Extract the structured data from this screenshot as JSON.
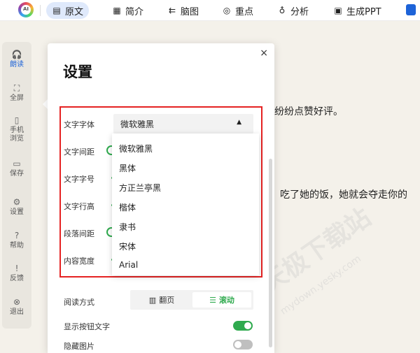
{
  "topbar": {
    "logo_text": "AI",
    "tabs": [
      {
        "label": "原文",
        "icon": "document-icon",
        "glyph": "▤"
      },
      {
        "label": "简介",
        "icon": "summary-icon",
        "glyph": "▦"
      },
      {
        "label": "脑图",
        "icon": "mindmap-icon",
        "glyph": "⇇"
      },
      {
        "label": "重点",
        "icon": "key-points-icon",
        "glyph": "◎"
      },
      {
        "label": "分析",
        "icon": "lightbulb-icon",
        "glyph": "♁"
      },
      {
        "label": "生成PPT",
        "icon": "ppt-icon",
        "glyph": "▣"
      }
    ]
  },
  "leftnav": {
    "items": [
      {
        "label": "朗读",
        "glyph": "🎧"
      },
      {
        "label": "全屏",
        "glyph": "⛶"
      },
      {
        "label": "手机\n浏览",
        "glyph": "▯"
      },
      {
        "label": "保存",
        "glyph": "▭"
      },
      {
        "label": "设置",
        "glyph": "⚙"
      },
      {
        "label": "帮助",
        "glyph": "?"
      },
      {
        "label": "反馈",
        "glyph": "!"
      },
      {
        "label": "退出",
        "glyph": "⊗"
      }
    ]
  },
  "document": {
    "line1": "纷纷点赞好评。",
    "line2": "吃了她的饭，她就会夺走你的"
  },
  "settings": {
    "title": "设置",
    "close_glyph": "×",
    "rows": {
      "font": "文字字体",
      "spacing": "文字间距",
      "size": "文字字号",
      "line_height": "文字行高",
      "paragraph": "段落间距",
      "width": "内容宽度",
      "read_mode": "阅读方式",
      "show_button_text": "显示按钮文字",
      "hide_images": "隐藏图片"
    },
    "font_select": {
      "value": "微软雅黑",
      "caret": "▲",
      "options": [
        "微软雅黑",
        "黑体",
        "方正兰亭黑",
        "楷体",
        "隶书",
        "宋体",
        "Arial"
      ]
    },
    "read_mode_options": {
      "page_flip": "翻页",
      "scroll": "滚动"
    },
    "show_button_text_on": true,
    "hide_images_on": false
  },
  "watermark": {
    "text": "天极下载站",
    "url": "mydown.yesky.com"
  }
}
